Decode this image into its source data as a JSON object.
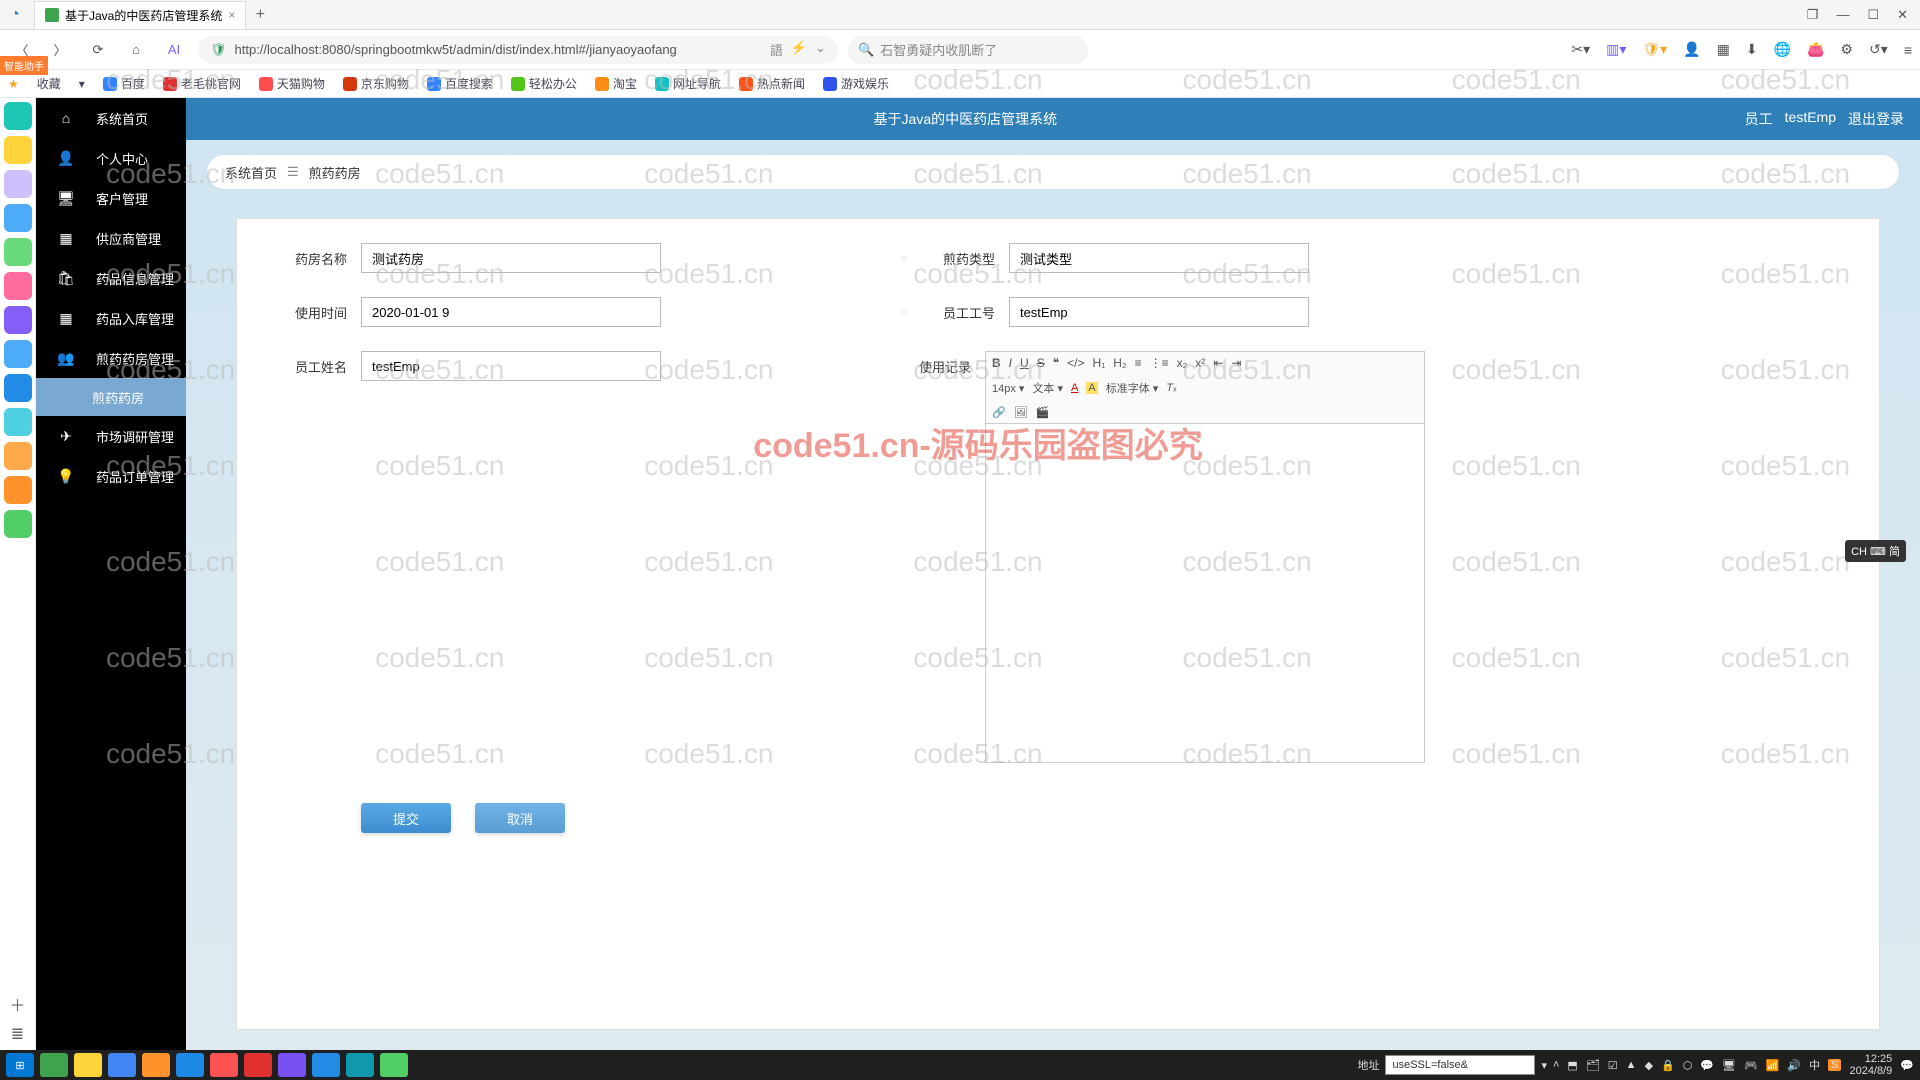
{
  "browser": {
    "tab_title": "基于Java的中医药店管理系统",
    "url": "http://localhost:8080/springbootmkw5t/admin/dist/index.html#/jianyaoyaofang",
    "search_placeholder": "石智勇疑内收肌断了",
    "favorites_label": "收藏",
    "bookmarks": [
      "百度",
      "老毛桃官网",
      "天猫购物",
      "京东购物",
      "百度搜索",
      "轻松办公",
      "淘宝",
      "网址导航",
      "热点新闻",
      "游戏娱乐"
    ],
    "orange_tag": "智能助手"
  },
  "window_controls": {
    "min": "—",
    "max": "☐",
    "close": "✕",
    "restore": "❐"
  },
  "app": {
    "topbar_title": "基于Java的中医药店管理系统",
    "user_role": "员工",
    "user_name": "testEmp",
    "logout": "退出登录",
    "sidebar": {
      "items": [
        {
          "icon": "⌂",
          "label": "系统首页"
        },
        {
          "icon": "👤",
          "label": "个人中心"
        },
        {
          "icon": "🖥",
          "label": "客户管理"
        },
        {
          "icon": "▦",
          "label": "供应商管理"
        },
        {
          "icon": "🛍",
          "label": "药品信息管理"
        },
        {
          "icon": "▦",
          "label": "药品入库管理"
        },
        {
          "icon": "👥",
          "label": "煎药药房管理",
          "sub": "煎药药房",
          "active": true
        },
        {
          "icon": "✈",
          "label": "市场调研管理"
        },
        {
          "icon": "💡",
          "label": "药品订单管理"
        }
      ]
    },
    "breadcrumb": {
      "home": "系统首页",
      "current": "煎药药房"
    },
    "form": {
      "pharmacy_name": {
        "label": "药房名称",
        "value": "测试药房"
      },
      "decoction_type": {
        "label": "煎药类型",
        "value": "测试类型"
      },
      "use_time": {
        "label": "使用时间",
        "value": "2020-01-01 9"
      },
      "emp_id": {
        "label": "员工工号",
        "value": "testEmp"
      },
      "emp_name": {
        "label": "员工姓名",
        "value": "testEmp"
      },
      "use_record": {
        "label": "使用记录"
      },
      "editor_font_size": "14px",
      "editor_text_label": "文本",
      "editor_font_family": "标准字体",
      "submit": "提交",
      "cancel": "取消"
    }
  },
  "watermark": "code51.cn",
  "watermark_red": "code51.cn-源码乐园盗图必究",
  "ime": "CH ⌨ 简",
  "taskbar": {
    "addr_label": "地址",
    "addr_value": "useSSL=false&",
    "time": "12:25",
    "date": "2024/8/9"
  }
}
